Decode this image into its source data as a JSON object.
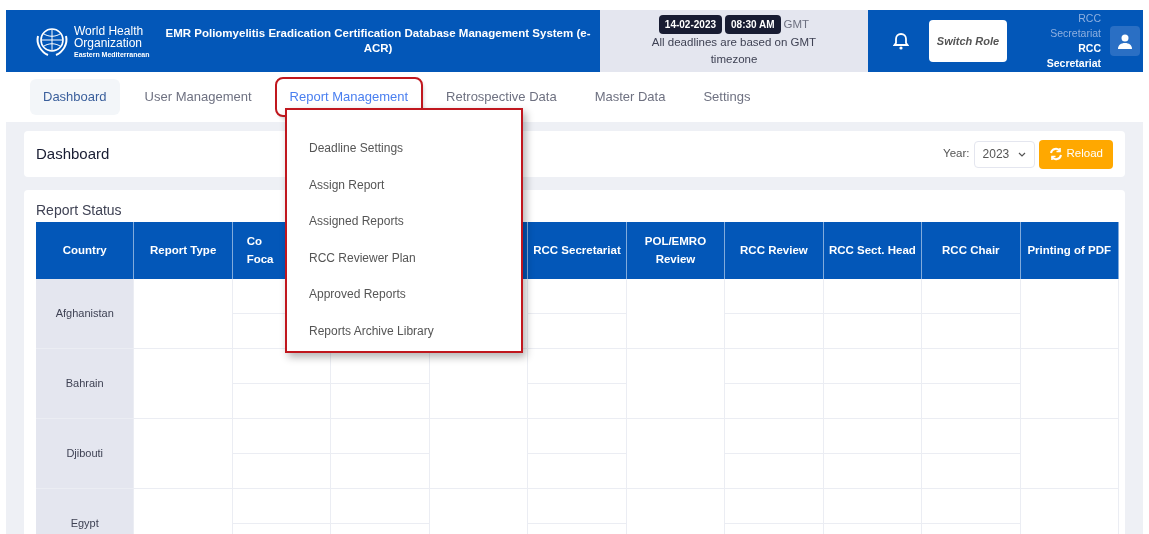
{
  "header": {
    "org_name": "World Health Organization",
    "org_region": "Eastern Mediterranean",
    "title": "EMR Poliomyelitis Eradication Certification Database Management System (e-ACR)",
    "date": "14-02-2023",
    "time": "08:30 AM",
    "timezone": "GMT",
    "deadline_note": "All deadlines are based on GMT timezone",
    "switch_role": "Switch Role",
    "role": "RCC Secretariat",
    "user": "RCC Secretariat"
  },
  "nav": [
    {
      "label": "Dashboard",
      "selected": true,
      "open": false
    },
    {
      "label": "User Management",
      "selected": false,
      "open": false
    },
    {
      "label": "Report Management",
      "selected": false,
      "open": true
    },
    {
      "label": "Retrospective Data",
      "selected": false,
      "open": false
    },
    {
      "label": "Master Data",
      "selected": false,
      "open": false
    },
    {
      "label": "Settings",
      "selected": false,
      "open": false
    }
  ],
  "menu": [
    "Deadline Settings",
    "Assign Report",
    "Assigned Reports",
    "RCC Reviewer Plan",
    "Approved Reports",
    "Reports Archive Library"
  ],
  "page": {
    "title": "Dashboard",
    "year_label": "Year:",
    "year": "2023",
    "reload": "Reload"
  },
  "table": {
    "title": "Report Status",
    "columns": [
      "Country",
      "Report Type",
      "Co Foca",
      "RCC Secretariat",
      "POL/EMRO Review",
      "RCC Review",
      "RCC Sect. Head",
      "RCC Chair",
      "Printing of PDF"
    ],
    "rows": [
      "Afghanistan",
      "Bahrain",
      "Djibouti",
      "Egypt"
    ]
  }
}
